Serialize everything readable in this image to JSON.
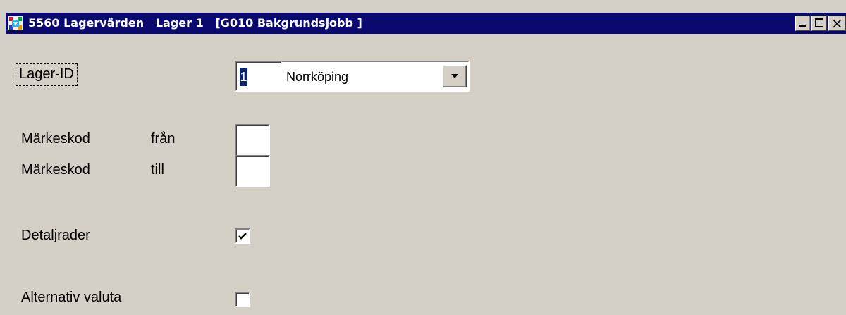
{
  "window": {
    "title": "5560 Lagervärden   Lager 1   [G010 Bakgrundsjobb ]",
    "icons": {
      "app": "app-icon",
      "minimize": "minimize-icon",
      "maximize": "maximize-icon",
      "close": "close-icon"
    },
    "close_glyph": "×"
  },
  "form": {
    "lager_id": {
      "label": "Lager-ID",
      "value": "1",
      "selected_option": "Norrköping"
    },
    "markeskod_fran": {
      "label": "Märkeskod",
      "qualifier": "från",
      "value": ""
    },
    "markeskod_till": {
      "label": "Märkeskod",
      "qualifier": "till",
      "value": ""
    },
    "detaljrader": {
      "label": "Detaljrader",
      "checked": true
    },
    "alternativ_valuta": {
      "label": "Alternativ valuta",
      "checked": false
    }
  },
  "colors": {
    "titlebar": "#0a0a6e",
    "window_face": "#d4d0c8",
    "selection": "#0a246a"
  }
}
